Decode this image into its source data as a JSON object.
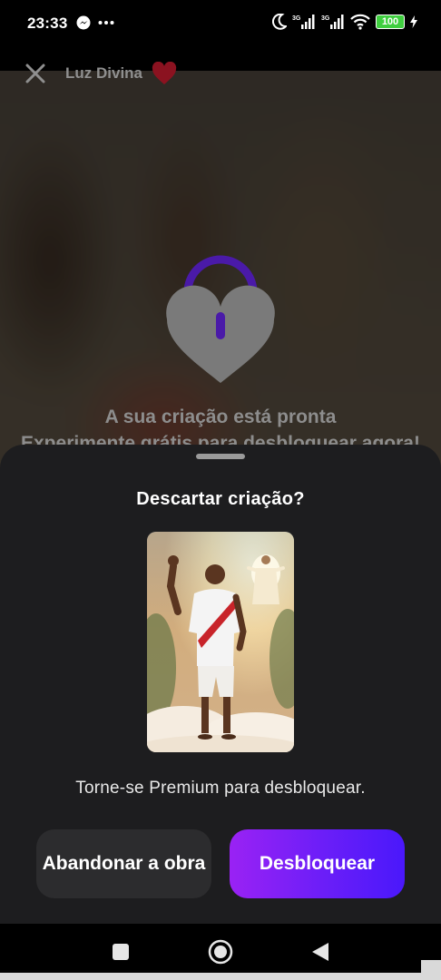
{
  "status_bar": {
    "time": "23:33",
    "battery": "100",
    "icons": [
      "messenger-icon",
      "more-dots-icon",
      "moon-icon",
      "signal-3g-icon",
      "signal-3g-icon",
      "wifi-icon",
      "battery-icon",
      "charging-icon"
    ]
  },
  "header": {
    "title": "Luz Divina",
    "close_icon": "close-icon",
    "heart_icon": "heart-icon",
    "heart_color": "#8b1220"
  },
  "locked_overlay": {
    "icon": "heart-lock-icon",
    "lock_accent": "#4a1aa8",
    "ready_text": "A sua criação está pronta",
    "subtext": "Experimente grátis para desbloquear agora!"
  },
  "dialog": {
    "title": "Descartar criação?",
    "preview_alt": "imagem gerada",
    "message": "Torne-se Premium para desbloquear.",
    "abandon_label": "Abandonar a obra",
    "unlock_label": "Desbloquear",
    "unlock_gradient": [
      "#9a22f4",
      "#4a18fb"
    ]
  },
  "nav_bar": {
    "buttons": [
      "recents-square-icon",
      "home-circle-icon",
      "back-triangle-icon"
    ]
  }
}
